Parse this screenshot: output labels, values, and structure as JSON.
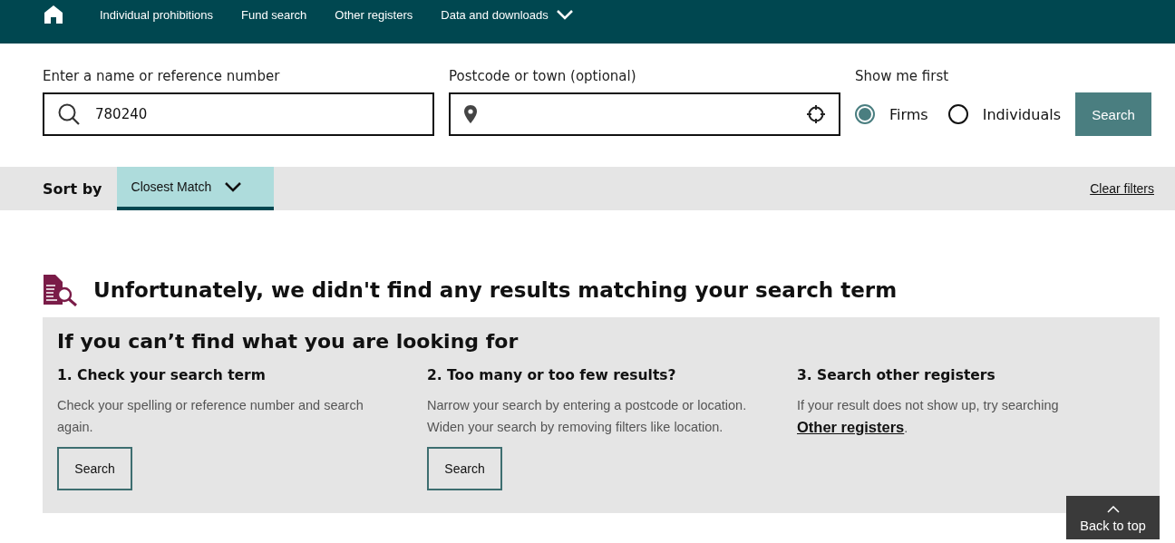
{
  "nav": {
    "items": [
      {
        "label": "Individual prohibitions",
        "dropdown": false
      },
      {
        "label": "Fund search",
        "dropdown": false
      },
      {
        "label": "Other registers",
        "dropdown": false
      },
      {
        "label": "Data and downloads",
        "dropdown": true
      }
    ]
  },
  "search": {
    "name_label": "Enter a name or reference number",
    "name_value": "780240",
    "location_label": "Postcode or town (optional)",
    "show_label": "Show me first",
    "options": [
      {
        "label": "Firms",
        "selected": true
      },
      {
        "label": "Individuals",
        "selected": false
      }
    ],
    "button": "Search"
  },
  "sort": {
    "label": "Sort by",
    "value": "Closest Match",
    "clear": "Clear filters"
  },
  "message": "Unfortunately, we didn't find any results matching your search term",
  "help": {
    "title": "If you can’t find what you are looking for",
    "columns": [
      {
        "kind": "button",
        "heading": "1. Check your search term",
        "text": "Check your spelling or reference number and search again.",
        "button": "Search"
      },
      {
        "kind": "button",
        "heading": "2. Too many or too few results?",
        "text": "Narrow your search by entering a postcode or location. Widen your search by removing filters like location.",
        "button": "Search"
      },
      {
        "kind": "link",
        "heading": "3. Search other registers",
        "text": "If your result does not show up, try searching",
        "link": "Other registers",
        "after": "."
      }
    ]
  },
  "back_to_top": "Back to top"
}
